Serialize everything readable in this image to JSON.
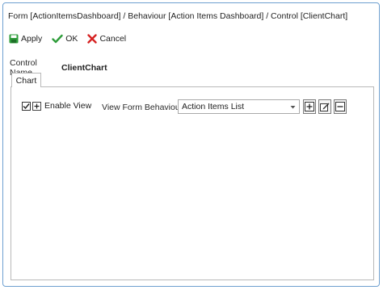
{
  "window": {
    "title": "Form [ActionItemsDashboard] / Behaviour [Action Items Dashboard] / Control [ClientChart]"
  },
  "toolbar": {
    "apply_label": "Apply",
    "ok_label": "OK",
    "cancel_label": "Cancel"
  },
  "control": {
    "name_label": "Control Name",
    "name_value": "ClientChart"
  },
  "tabs": [
    {
      "label": "Chart",
      "active": true
    }
  ],
  "chart_tab": {
    "enable_view_label": "Enable View",
    "enable_view_checked": true,
    "view_form_behaviour_label": "View Form Behaviour",
    "view_form_behaviour_value": "Action Items List"
  },
  "colors": {
    "apply_icon": "#2e9c3a",
    "ok_icon": "#2e9c3a",
    "cancel_icon": "#d62222",
    "window_border": "#6ea0d0"
  },
  "icons": {
    "apply": "save-icon",
    "ok": "check-icon",
    "cancel": "close-icon",
    "add": "add-icon",
    "edit": "edit-icon",
    "remove": "remove-icon"
  }
}
